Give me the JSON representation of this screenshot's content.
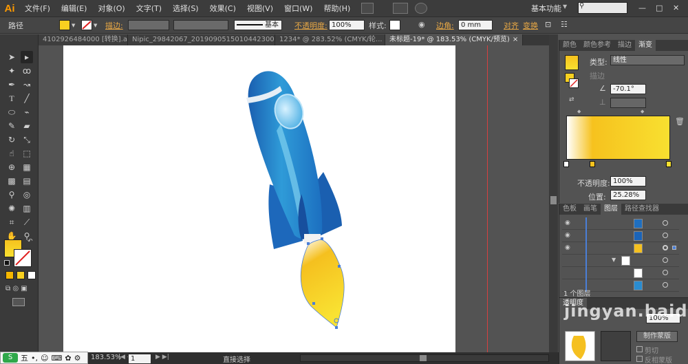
{
  "app": {
    "logo": "Ai",
    "menu": [
      "文件(F)",
      "编辑(E)",
      "对象(O)",
      "文字(T)",
      "选择(S)",
      "效果(C)",
      "视图(V)",
      "窗口(W)",
      "帮助(H)"
    ],
    "workspace": "基本功能",
    "window_controls": [
      "—",
      "□",
      "✕"
    ]
  },
  "control_bar": {
    "selection_type": "路径",
    "fill_color": "#f8d020",
    "stroke_label": "描边:",
    "stroke_style": "基本",
    "opacity_label": "不透明度:",
    "opacity_value": "100%",
    "style_label": "样式:",
    "corner_label": "边角:",
    "corner_value": "0 mm",
    "align_label": "对齐",
    "transform_label": "变换"
  },
  "doc_tabs": [
    {
      "label": "4102926484000 [转换].ai*",
      "active": false
    },
    {
      "label": "Nipic_29842067_20190905150104423000.ai*",
      "active": false
    },
    {
      "label": "1234* @ 283.52% (CMYK/轮...",
      "active": false
    },
    {
      "label": "未标题-19* @ 183.53% (CMYK/预览)",
      "active": true
    }
  ],
  "tools": [
    "selection-tool",
    "direct-selection-tool",
    "magic-wand-tool",
    "lasso-tool",
    "pen-tool",
    "curvature-tool",
    "type-tool",
    "line-tool",
    "ellipse-tool",
    "paintbrush-tool",
    "pencil-tool",
    "eraser-tool",
    "rotate-tool",
    "scale-tool",
    "warp-tool",
    "free-transform-tool",
    "shape-builder-tool",
    "chart-tool",
    "mesh-tool",
    "gradient-tool",
    "eyedropper-tool",
    "blend-tool",
    "symbol-sprayer-tool",
    "column-graph-tool",
    "artboard-tool",
    "slice-tool",
    "hand-tool",
    "zoom-tool"
  ],
  "gradient_panel": {
    "tabs": [
      "颜色",
      "颜色参考",
      "描边",
      "渐变"
    ],
    "type_label": "类型:",
    "type_value": "线性",
    "stroke_label": "描边",
    "angle_value": "-70.1°",
    "opacity_label": "不透明度:",
    "opacity_value": "100%",
    "position_label": "位置:",
    "position_value": "25.28%",
    "gradient_colors": [
      "#ffffff",
      "#f6c21e",
      "#f8e030"
    ]
  },
  "layers_panel": {
    "tabs": [
      "色板",
      "画笔",
      "图层",
      "路径查找器"
    ],
    "rows": [
      {
        "visible": true,
        "indent": 0,
        "thumb": "#1f6fc0"
      },
      {
        "visible": true,
        "indent": 0,
        "thumb": "#1b64b8"
      },
      {
        "visible": true,
        "indent": 0,
        "thumb": "#f5c020",
        "selected": true
      },
      {
        "visible": false,
        "indent": 1,
        "expander": "▼",
        "thumb": "#ffffff"
      },
      {
        "visible": false,
        "indent": 2,
        "thumb": "#ffffff"
      },
      {
        "visible": false,
        "indent": 2,
        "thumb": "#2a8cd0"
      }
    ],
    "footer": "1 个图层"
  },
  "transparency_panel": {
    "tabs": [
      "透明度"
    ],
    "opacity_value": "100%",
    "make_mask_label": "制作蒙版",
    "clip_label": "剪切",
    "invert_label": "反相蒙版"
  },
  "status_bar": {
    "zoom": "183.53%",
    "page": "1",
    "tool_name": "直接选择"
  },
  "ime": {
    "label": "五"
  },
  "watermark": "jingyan.baidu"
}
